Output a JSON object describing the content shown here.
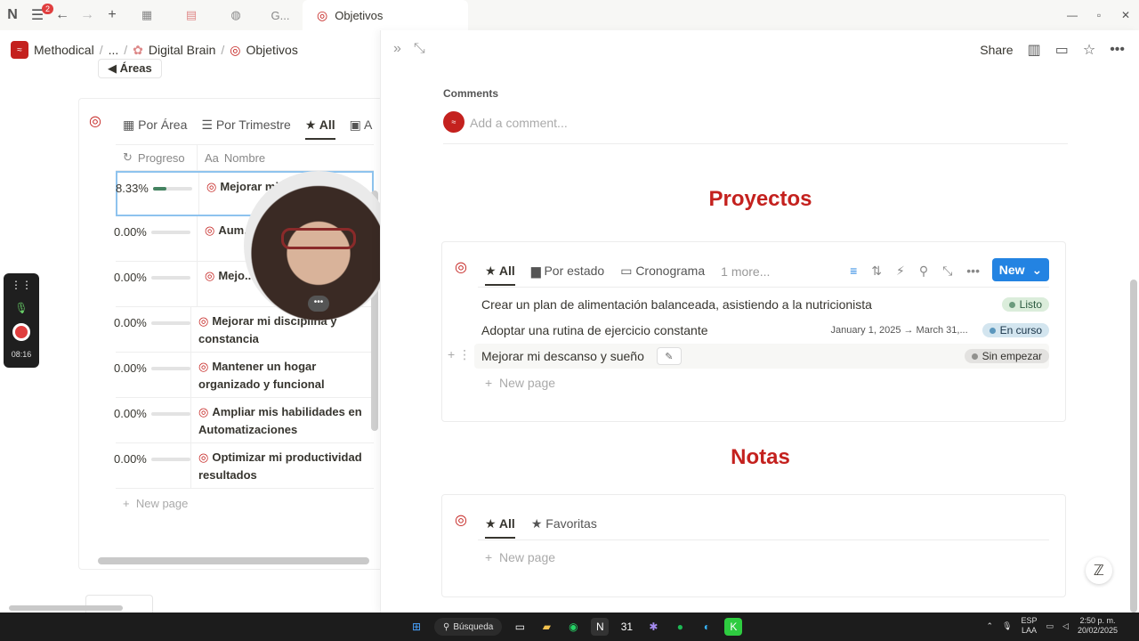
{
  "titlebar": {
    "notifications": "2",
    "tabs": [
      {
        "label": ""
      },
      {
        "label": ""
      },
      {
        "label": ""
      },
      {
        "label": "G..."
      },
      {
        "label": "Objetivos"
      }
    ]
  },
  "breadcrumb": {
    "workspace": "Methodical",
    "ellipsis": "...",
    "parent": "Digital Brain",
    "current": "Objetivos"
  },
  "left": {
    "areas_chip": "Áreas",
    "views": [
      "Por Área",
      "Por Trimestre",
      "All",
      "A"
    ],
    "columns": {
      "progress": "Progreso",
      "name": "Nombre",
      "name_prefix": "Aa"
    },
    "rows": [
      {
        "pct": "8.33%",
        "fill": 0.33,
        "name": "Mejorar mi ... energía di..."
      },
      {
        "pct": "0.00%",
        "fill": 0,
        "name": "Aum... forma e..."
      },
      {
        "pct": "0.00%",
        "fill": 0,
        "name": "Mejo... sociales y r..."
      },
      {
        "pct": "0.00%",
        "fill": 0,
        "name": "Mejorar mi disciplina y constancia"
      },
      {
        "pct": "0.00%",
        "fill": 0,
        "name": "Mantener un hogar organizado y funcional"
      },
      {
        "pct": "0.00%",
        "fill": 0,
        "name": "Ampliar mis habilidades en Automatizaciones"
      },
      {
        "pct": "0.00%",
        "fill": 0,
        "name": "Optimizar mi productividad resultados"
      }
    ],
    "new_page": "New page"
  },
  "recorder": {
    "time": "08:16"
  },
  "right": {
    "share": "Share",
    "comments_label": "Comments",
    "comment_placeholder": "Add a comment...",
    "proyectos_heading": "Proyectos",
    "proyectos": {
      "tabs": [
        "All",
        "Por estado",
        "Cronograma",
        "1 more..."
      ],
      "new_label": "New",
      "rows": [
        {
          "name": "Crear un plan de alimentación balanceada, asistiendo a la nutricionista",
          "date": "",
          "status": "Listo",
          "status_color": "#dbeddb"
        },
        {
          "name": "Adoptar una rutina de ejercicio constante",
          "date": "January 1, 2025 → March 31,...",
          "status": "En curso",
          "status_color": "#d3e5ef"
        },
        {
          "name": "Mejorar mi descanso y sueño",
          "date": "",
          "status": "Sin empezar",
          "status_color": "#e3e2e0"
        }
      ],
      "new_page": "New page"
    },
    "notas_heading": "Notas",
    "notas": {
      "tabs": [
        "All",
        "Favoritas"
      ],
      "new_page": "New page"
    }
  },
  "taskbar": {
    "search": "Búsqueda",
    "lang_top": "ESP",
    "lang_bottom": "LAA",
    "time": "2:50 p. m.",
    "date": "20/02/2025"
  },
  "colors": {
    "accent": "#c4211e",
    "primary": "#2383e2",
    "progress": "#448361"
  }
}
